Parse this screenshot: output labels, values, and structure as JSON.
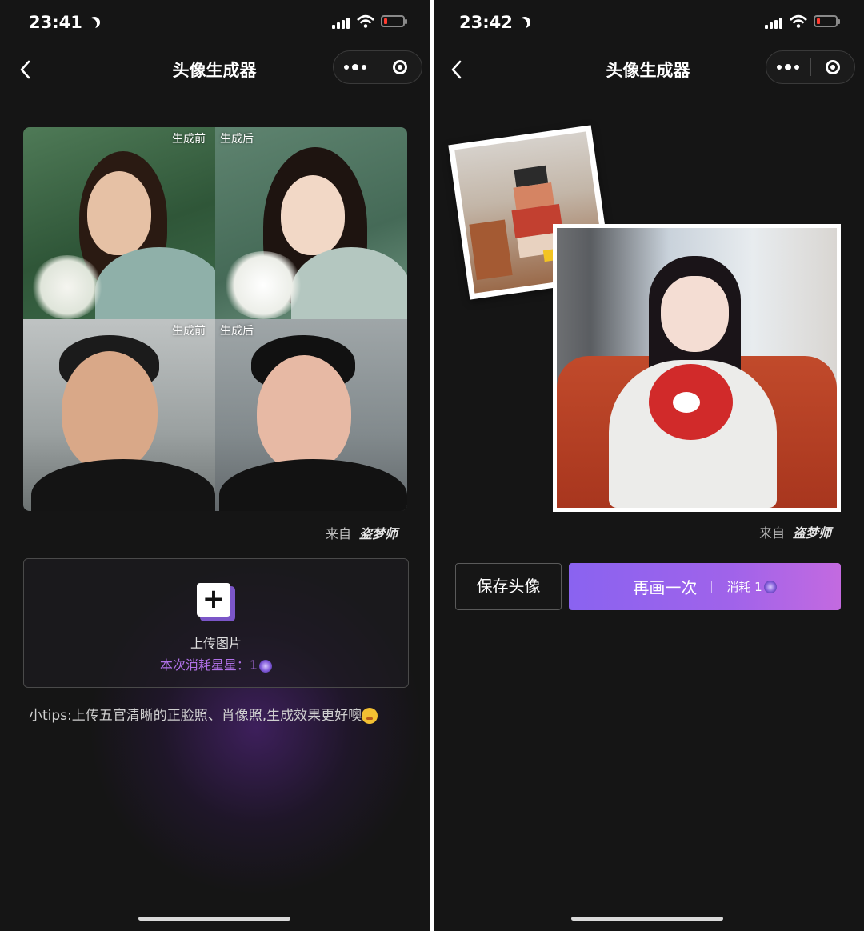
{
  "left": {
    "status_time": "23:41",
    "nav_title": "头像生成器",
    "grid_labels": {
      "before_top": "生成前",
      "after_top": "生成后",
      "before_bottom": "生成前",
      "after_bottom": "生成后"
    },
    "source_prefix": "来自",
    "source_brand": "盗梦师",
    "upload_label": "上传图片",
    "cost_label": "本次消耗星星：",
    "cost_value": "1",
    "tips": "小tips:上传五官清晰的正脸照、肖像照,生成效果更好噢"
  },
  "right": {
    "status_time": "23:42",
    "nav_title": "头像生成器",
    "source_prefix": "来自",
    "source_brand": "盗梦师",
    "save_button": "保存头像",
    "redraw_button": "再画一次",
    "redraw_cost": "消耗 1"
  },
  "colors": {
    "background": "#151515",
    "accent_purple": "#8a63f0",
    "cost_text": "#b071e8",
    "battery_low": "#ff3b30"
  },
  "icons": {
    "back": "chevron-left-icon",
    "more": "more-dots-icon",
    "close": "target-circle-icon",
    "upload": "plus-icon",
    "currency": "star-icon",
    "emoji": "grin-emoji-icon"
  }
}
